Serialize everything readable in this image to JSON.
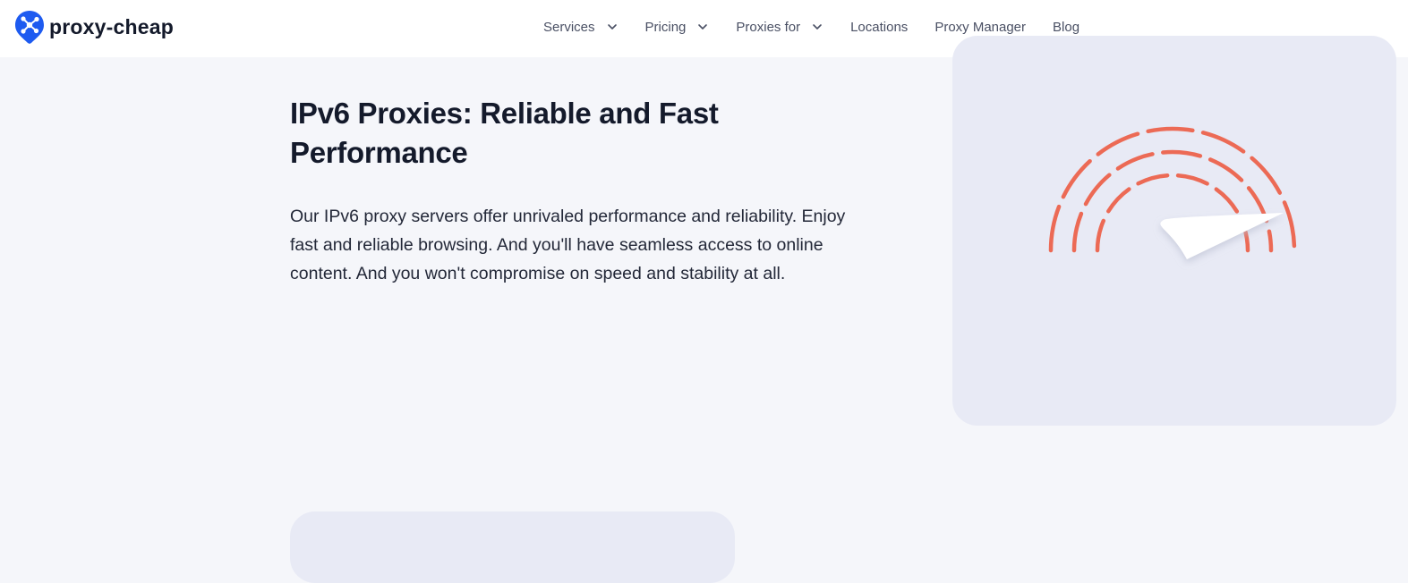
{
  "brand": {
    "name": "proxy-cheap",
    "accent": "#1e5bf0"
  },
  "nav": {
    "items": [
      {
        "label": "Services",
        "has_dropdown": true,
        "icon": "chevron-down-icon"
      },
      {
        "label": "Pricing",
        "has_dropdown": true,
        "icon": "chevron-down-icon"
      },
      {
        "label": "Proxies for",
        "has_dropdown": true,
        "icon": "chevron-down-icon"
      },
      {
        "label": "Locations",
        "has_dropdown": false
      },
      {
        "label": "Proxy Manager",
        "has_dropdown": false
      },
      {
        "label": "Blog",
        "has_dropdown": false
      }
    ]
  },
  "hero": {
    "title": "IPv6 Proxies: Reliable and Fast Performance",
    "description": "Our IPv6 proxy servers offer unrivaled performance and reliability. Enjoy fast and reliable browsing. And you'll have seamless access to online content. And you won't compromise on speed and stability at all."
  },
  "illustration": {
    "icon": "speedometer-icon",
    "arc_color": "#ec6a55",
    "card_color": "#e8eaf5"
  }
}
